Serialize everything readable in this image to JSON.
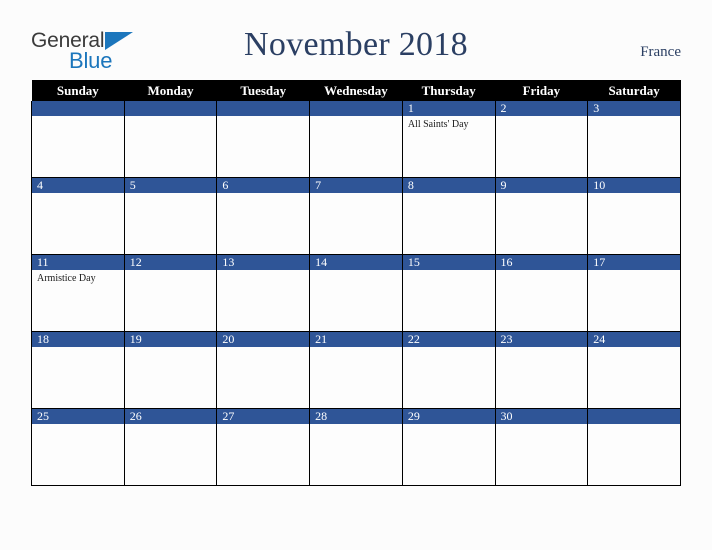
{
  "brand": {
    "name_part1": "General",
    "name_part2": "Blue",
    "triangle_icon": "triangle-icon",
    "accent_color": "#1c76bc"
  },
  "header": {
    "title": "November 2018",
    "country": "France",
    "title_color": "#2b3f63"
  },
  "calendar": {
    "header_background": "#000000",
    "daybar_color": "#2f5597",
    "weekdays": [
      "Sunday",
      "Monday",
      "Tuesday",
      "Wednesday",
      "Thursday",
      "Friday",
      "Saturday"
    ],
    "weeks": [
      [
        {
          "day": "",
          "events": ""
        },
        {
          "day": "",
          "events": ""
        },
        {
          "day": "",
          "events": ""
        },
        {
          "day": "",
          "events": ""
        },
        {
          "day": "1",
          "events": "All Saints' Day"
        },
        {
          "day": "2",
          "events": ""
        },
        {
          "day": "3",
          "events": ""
        }
      ],
      [
        {
          "day": "4",
          "events": ""
        },
        {
          "day": "5",
          "events": ""
        },
        {
          "day": "6",
          "events": ""
        },
        {
          "day": "7",
          "events": ""
        },
        {
          "day": "8",
          "events": ""
        },
        {
          "day": "9",
          "events": ""
        },
        {
          "day": "10",
          "events": ""
        }
      ],
      [
        {
          "day": "11",
          "events": "Armistice Day"
        },
        {
          "day": "12",
          "events": ""
        },
        {
          "day": "13",
          "events": ""
        },
        {
          "day": "14",
          "events": ""
        },
        {
          "day": "15",
          "events": ""
        },
        {
          "day": "16",
          "events": ""
        },
        {
          "day": "17",
          "events": ""
        }
      ],
      [
        {
          "day": "18",
          "events": ""
        },
        {
          "day": "19",
          "events": ""
        },
        {
          "day": "20",
          "events": ""
        },
        {
          "day": "21",
          "events": ""
        },
        {
          "day": "22",
          "events": ""
        },
        {
          "day": "23",
          "events": ""
        },
        {
          "day": "24",
          "events": ""
        }
      ],
      [
        {
          "day": "25",
          "events": ""
        },
        {
          "day": "26",
          "events": ""
        },
        {
          "day": "27",
          "events": ""
        },
        {
          "day": "28",
          "events": ""
        },
        {
          "day": "29",
          "events": ""
        },
        {
          "day": "30",
          "events": ""
        },
        {
          "day": "",
          "events": ""
        }
      ]
    ]
  }
}
